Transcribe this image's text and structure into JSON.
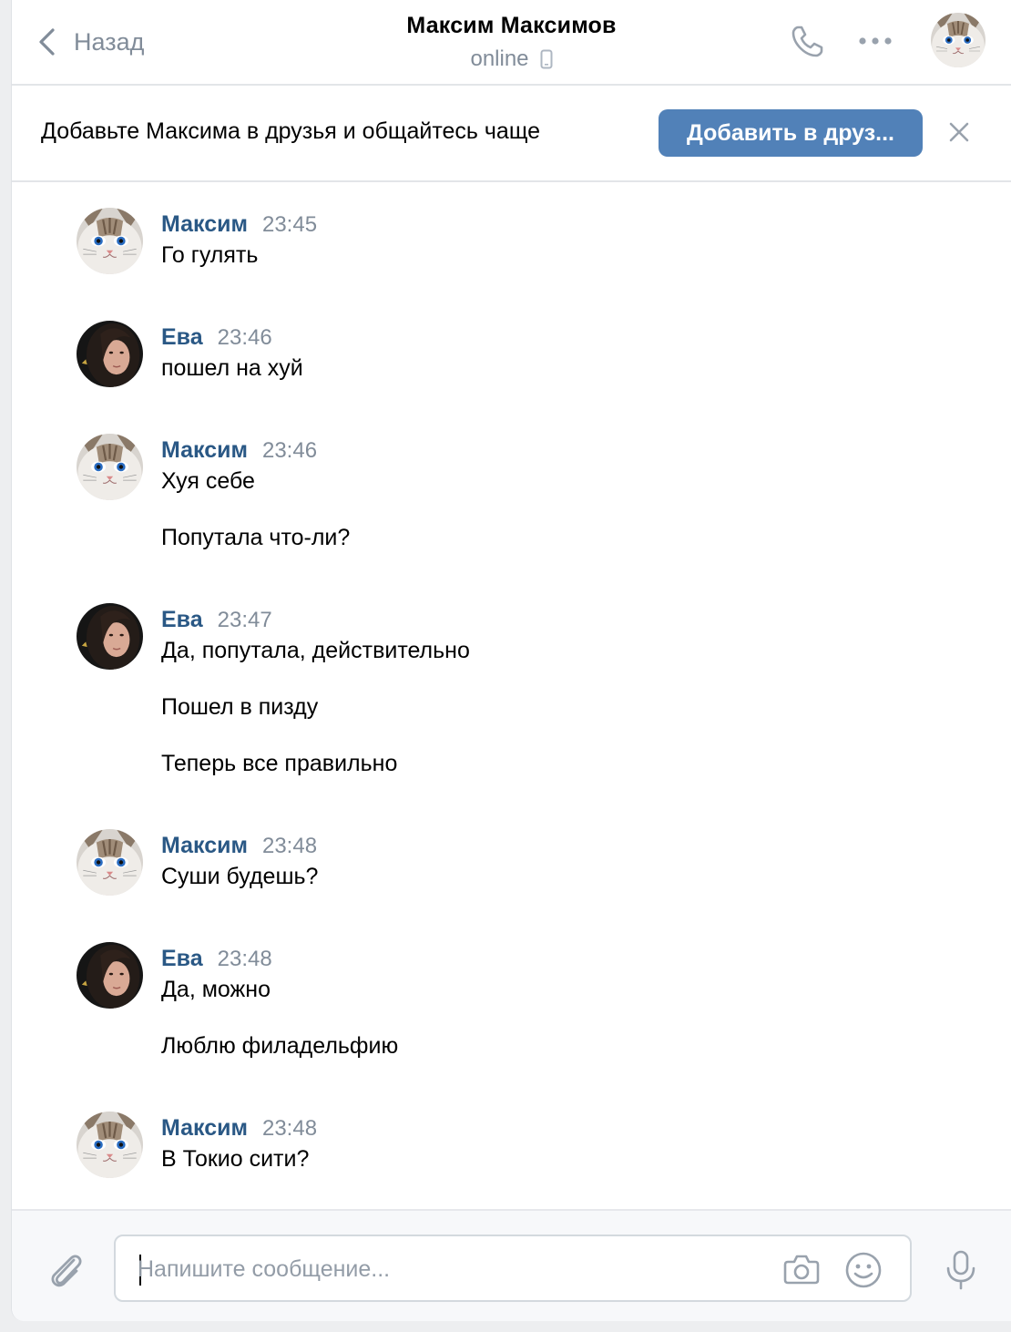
{
  "header": {
    "back_label": "Назад",
    "title": "Максим Максимов",
    "status": "online"
  },
  "banner": {
    "text": "Добавьте Максима в друзья и общайтесь чаще",
    "button_label": "Добавить в друз..."
  },
  "messages": [
    {
      "author": "Максим",
      "time": "23:45",
      "avatar": "cat",
      "lines": [
        "Го гулять"
      ]
    },
    {
      "author": "Ева",
      "time": "23:46",
      "avatar": "girl",
      "lines": [
        "пошел на хуй"
      ]
    },
    {
      "author": "Максим",
      "time": "23:46",
      "avatar": "cat",
      "lines": [
        "Хуя себе",
        "Попутала что-ли?"
      ]
    },
    {
      "author": "Ева",
      "time": "23:47",
      "avatar": "girl",
      "lines": [
        "Да, попутала, действительно",
        "Пошел в пизду",
        "Теперь все правильно"
      ]
    },
    {
      "author": "Максим",
      "time": "23:48",
      "avatar": "cat",
      "lines": [
        "Суши будешь?"
      ]
    },
    {
      "author": "Ева",
      "time": "23:48",
      "avatar": "girl",
      "lines": [
        "Да, можно",
        "Люблю филадельфию"
      ]
    },
    {
      "author": "Максим",
      "time": "23:48",
      "avatar": "cat",
      "lines": [
        "В Токио сити?"
      ]
    }
  ],
  "composer": {
    "placeholder": "Напишите сообщение..."
  },
  "colors": {
    "accent": "#5181b8",
    "author": "#2a5885",
    "muted": "#818c99"
  },
  "icons": {
    "back": "chevron-left-icon",
    "call": "phone-icon",
    "more": "more-dots-icon",
    "close": "close-icon",
    "attach": "paperclip-icon",
    "camera": "camera-icon",
    "emoji": "smile-icon",
    "mic": "microphone-icon",
    "mobile": "mobile-phone-icon"
  }
}
